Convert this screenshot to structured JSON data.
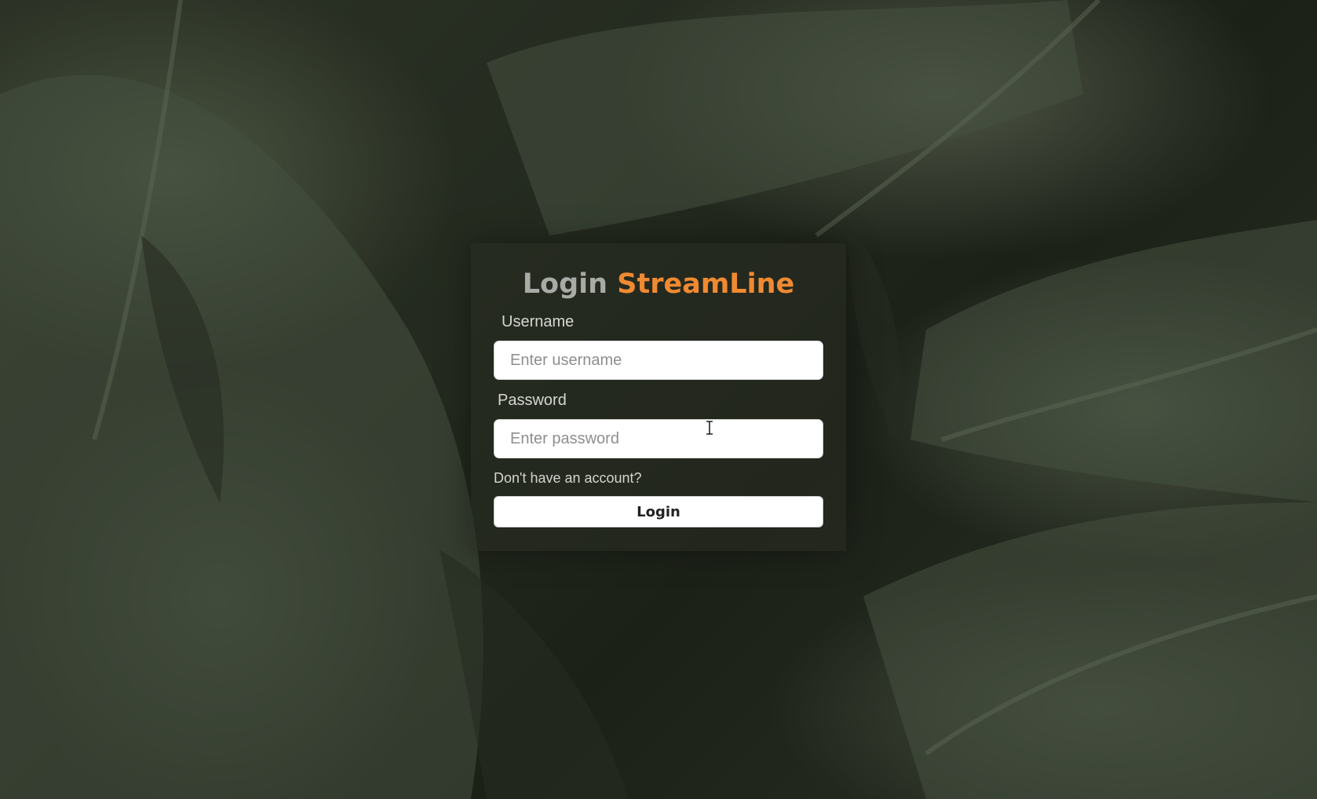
{
  "login": {
    "title_prefix": "Login",
    "title_brand": "StreamLine",
    "username_label": "Username",
    "username_placeholder": "Enter username",
    "username_value": "",
    "password_label": "Password",
    "password_placeholder": "Enter password",
    "password_value": "",
    "signup_prompt": "Don't have an account?",
    "submit_label": "Login"
  },
  "colors": {
    "brand_accent": "#f08a32",
    "title_muted": "#a9aaa6",
    "button_background": "#ffffff"
  },
  "background": {
    "icon": "tropical-leaves-image"
  }
}
